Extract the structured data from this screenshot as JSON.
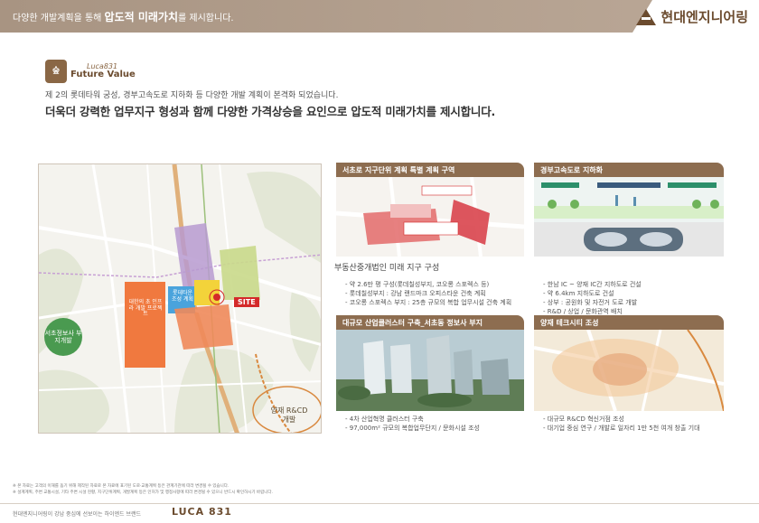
{
  "banner": {
    "text_prefix": "다양한 개발계획을 통해 ",
    "text_strong": "압도적 미래가치",
    "text_suffix": "를 제시합니다.",
    "brand_name": "현대엔지니어링"
  },
  "logo": {
    "small": "Luca831",
    "big": "Future Value",
    "badge": "숲"
  },
  "headline": {
    "line1": "제 2의 롯데타워 궁성, 경부고속도로 지하화 등 다양한 개발 계획이 본격화 되었습니다.",
    "line2": "더욱더 강력한 업무지구 형성과 함께 다양한 가격상승을 요인으로 압도적 미래가치를 제시합니다."
  },
  "map": {
    "site": "SITE",
    "rd_label": "양재 R&CD 개발",
    "seocho_label": "서초정보사 부지개발",
    "tag_1": "롯데타운 조성 계획",
    "tag_2": "대한의 초 인프라 개발 프로젝트"
  },
  "panels": {
    "p1": {
      "title": "서초로 지구단위 계획 특별 계획 구역",
      "items": [
        "- 약 2.6만 평 구성(롯데칠성부지, 코오롱 스포렉스 등)",
        "- 롯데칠성부지 : 강남 랜드마크 오피스타운 건축 계획",
        "- 코오롱 스포렉스 부지 : 25층 규모의 복합 업무시설 건축 계획"
      ]
    },
    "p2": {
      "title": "경부고속도로 지하화",
      "items": [
        "- 한남 IC ~ 양재 IC간 지하도로 건설",
        "- 약 6.4km 지하도로 건설",
        "- 상부 : 공원화 및 자전거 도로 개발",
        "- R&D / 상업 / 문화관역 배치"
      ]
    },
    "p3": {
      "title": "대규모 산업클러스터 구축_서초동 정보사 부지",
      "items": [
        "- 4차 산업혁명 클러스터 구축",
        "- 97,000m² 규모의 복합업무단지 / 문화시설 조성"
      ]
    },
    "p4": {
      "title": "양재 테크시티 조성",
      "items": [
        "- 대규모 R&CD 혁신거점 조성",
        "- 대기업 중심 연구 / 개발로 일자리 1만 5천 여개 창출 기대"
      ]
    }
  },
  "overlay_text": "부동산중개법인 미래 지구 구성",
  "notes": [
    "※ 본 자료는 고객의 이해를 돕기 위해 제작된 자료로 본 자료에 표기된 도로·교통계획 등은 관계기관에 따라 변경될 수 있습니다.",
    "※ 설계계획, 주변 교통시설, 기타 주변 시설 현황, 지구단위계획, 개발계획 등은 인허가 및 행정사항에 따라 변경될 수 있으니 반드시 확인하시기 바랍니다."
  ],
  "footer": {
    "text": "현대엔지니어링이 강남 중심에 선보이는 하이엔드 브랜드",
    "logo": "LUCA 831"
  },
  "colors": {
    "brand": "#6b4b2e",
    "banner": "#a89482",
    "panel_title": "#8d6d50",
    "site_red": "#d42a2a"
  }
}
